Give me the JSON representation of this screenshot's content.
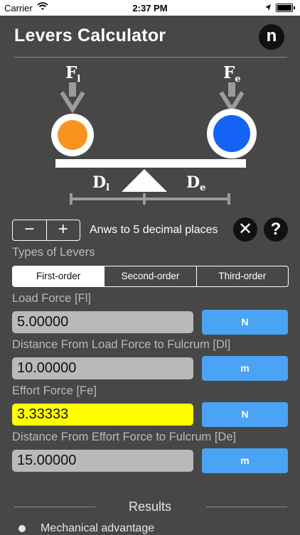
{
  "status_bar": {
    "carrier": "Carrier",
    "time": "2:37 PM"
  },
  "header": {
    "title": "Levers Calculator",
    "logo_letter": "n"
  },
  "diagram": {
    "load_force_label": "F",
    "load_force_sub": "l",
    "effort_force_label": "F",
    "effort_force_sub": "e",
    "load_distance_label": "D",
    "load_distance_sub": "l",
    "effort_distance_label": "D",
    "effort_distance_sub": "e",
    "load_color": "#f7931e",
    "effort_color": "#1463f5"
  },
  "precision": {
    "minus_label": "−",
    "plus_label": "+",
    "text": "Anws to 5 decimal places",
    "clear_icon": "✕",
    "help_icon": "?"
  },
  "lever_types": {
    "label": "Types of Levers",
    "options": [
      "First-order",
      "Second-order",
      "Third-order"
    ],
    "selected": "First-order"
  },
  "fields": {
    "load_force": {
      "label": "Load Force [Fl]",
      "value": "5.00000",
      "unit": "N"
    },
    "load_distance": {
      "label": "Distance From Load Force to Fulcrum [Dl]",
      "value": "10.00000",
      "unit": "m"
    },
    "effort_force": {
      "label": "Effort Force [Fe]",
      "value": "3.33333",
      "unit": "N"
    },
    "effort_distance": {
      "label": "Distance From Effort Force to Fulcrum [De]",
      "value": "15.00000",
      "unit": "m"
    }
  },
  "results": {
    "title": "Results",
    "first_item": "Mechanical advantage"
  },
  "colors": {
    "background": "#474747",
    "unit_button": "#4aa3f4",
    "highlight": "#ffff00",
    "input": "#b9b9b9"
  }
}
